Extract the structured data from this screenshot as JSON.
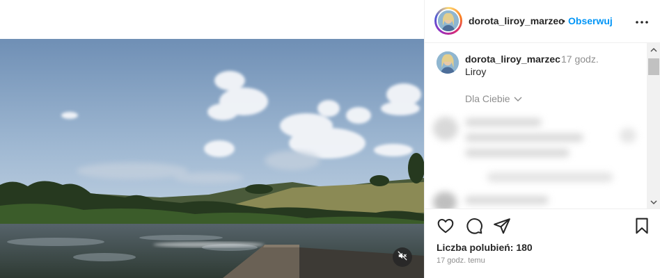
{
  "post": {
    "username": "dorota_liroy_marzec",
    "follow_label": "Obserwuj",
    "separator": "•",
    "caption_username": "dorota_liroy_marzec",
    "caption_time": "17 godz.",
    "caption_text": "Liroy",
    "filter_label": "Dla Ciebie",
    "likes_label": "Liczba polubień: 180",
    "post_time": "17 godz. temu"
  },
  "icons": {
    "more": "more-options-icon",
    "like": "heart-icon",
    "comment": "comment-icon",
    "share": "share-icon",
    "save": "bookmark-icon",
    "mute": "speaker-muted-icon"
  },
  "colors": {
    "follow": "#0095f6",
    "text": "#262626",
    "muted": "#8e8e8e"
  }
}
